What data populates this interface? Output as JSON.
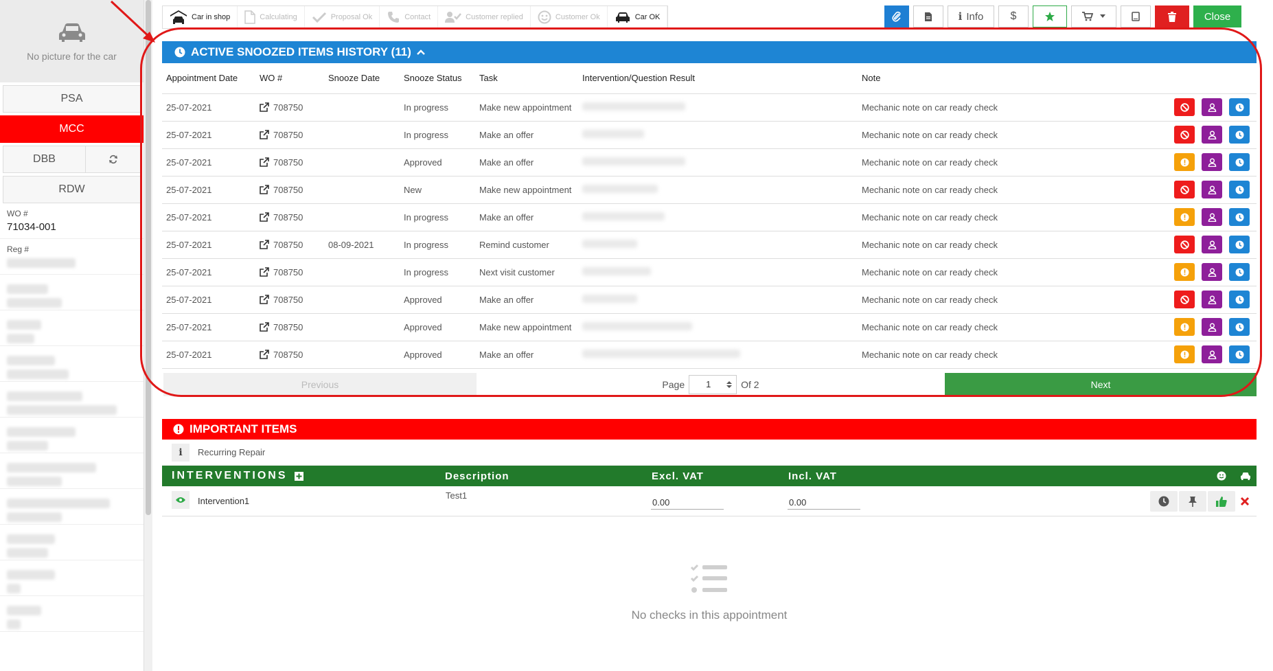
{
  "sidebar": {
    "no_picture": "No picture for the car",
    "buttons": [
      "PSA",
      "MCC",
      "DBB",
      "RDW"
    ],
    "wo_label": "WO #",
    "wo_value": "71034-001",
    "reg_label": "Reg #"
  },
  "steps": [
    {
      "label": "Car in shop",
      "icon": "garage-icon",
      "done": true
    },
    {
      "label": "Calculating",
      "icon": "document-icon",
      "done": false
    },
    {
      "label": "Proposal Ok",
      "icon": "check-icon",
      "done": false
    },
    {
      "label": "Contact",
      "icon": "phone-icon",
      "done": false
    },
    {
      "label": "Customer replied",
      "icon": "user-check-icon",
      "done": false
    },
    {
      "label": "Customer Ok",
      "icon": "smile-icon",
      "done": false
    },
    {
      "label": "Car OK",
      "icon": "car-icon",
      "done": true
    }
  ],
  "toolbar": {
    "info_label": "Info",
    "dollar_label": "$",
    "close_label": "Close"
  },
  "snoozed": {
    "title": "ACTIVE SNOOZED ITEMS HISTORY (11)",
    "columns": [
      "Appointment Date",
      "WO #",
      "Snooze Date",
      "Snooze Status",
      "Task",
      "Intervention/Question Result",
      "Note"
    ],
    "rows": [
      {
        "date": "25-07-2021",
        "wo": "708750",
        "snooze_date": "",
        "status": "In progress",
        "task": "Make new appointment",
        "note": "Mechanic note on car ready check",
        "first_color": "red"
      },
      {
        "date": "25-07-2021",
        "wo": "708750",
        "snooze_date": "",
        "status": "In progress",
        "task": "Make an offer",
        "note": "Mechanic note on car ready check",
        "first_color": "red"
      },
      {
        "date": "25-07-2021",
        "wo": "708750",
        "snooze_date": "",
        "status": "Approved",
        "task": "Make an offer",
        "note": "Mechanic note on car ready check",
        "first_color": "orange"
      },
      {
        "date": "25-07-2021",
        "wo": "708750",
        "snooze_date": "",
        "status": "New",
        "task": "Make new appointment",
        "note": "Mechanic note on car ready check",
        "first_color": "red"
      },
      {
        "date": "25-07-2021",
        "wo": "708750",
        "snooze_date": "",
        "status": "In progress",
        "task": "Make an offer",
        "note": "Mechanic note on car ready check",
        "first_color": "orange"
      },
      {
        "date": "25-07-2021",
        "wo": "708750",
        "snooze_date": "08-09-2021",
        "status": "In progress",
        "task": "Remind customer",
        "note": "Mechanic note on car ready check",
        "first_color": "red"
      },
      {
        "date": "25-07-2021",
        "wo": "708750",
        "snooze_date": "",
        "status": "In progress",
        "task": "Next visit customer",
        "note": "Mechanic note on car ready check",
        "first_color": "orange"
      },
      {
        "date": "25-07-2021",
        "wo": "708750",
        "snooze_date": "",
        "status": "Approved",
        "task": "Make an offer",
        "note": "Mechanic note on car ready check",
        "first_color": "red"
      },
      {
        "date": "25-07-2021",
        "wo": "708750",
        "snooze_date": "",
        "status": "Approved",
        "task": "Make new appointment",
        "note": "Mechanic note on car ready check",
        "first_color": "orange"
      },
      {
        "date": "25-07-2021",
        "wo": "708750",
        "snooze_date": "",
        "status": "Approved",
        "task": "Make an offer",
        "note": "Mechanic note on car ready check",
        "first_color": "orange"
      }
    ],
    "pager": {
      "previous": "Previous",
      "page_label": "Page",
      "page_value": "1",
      "of_label": "Of 2",
      "next": "Next"
    }
  },
  "important": {
    "title": "IMPORTANT ITEMS",
    "item": "Recurring Repair"
  },
  "interventions": {
    "title": "INTERVENTIONS",
    "col_description": "Description",
    "col_excl": "Excl. VAT",
    "col_incl": "Incl. VAT",
    "row": {
      "name": "Intervention1",
      "description": "Test1",
      "excl": "0.00",
      "incl": "0.00"
    }
  },
  "empty_checks": "No checks in this appointment",
  "colors": {
    "blue": "#1e85d4",
    "red": "#ff0000",
    "green": "#227a2b",
    "annotation": "#e01818"
  }
}
